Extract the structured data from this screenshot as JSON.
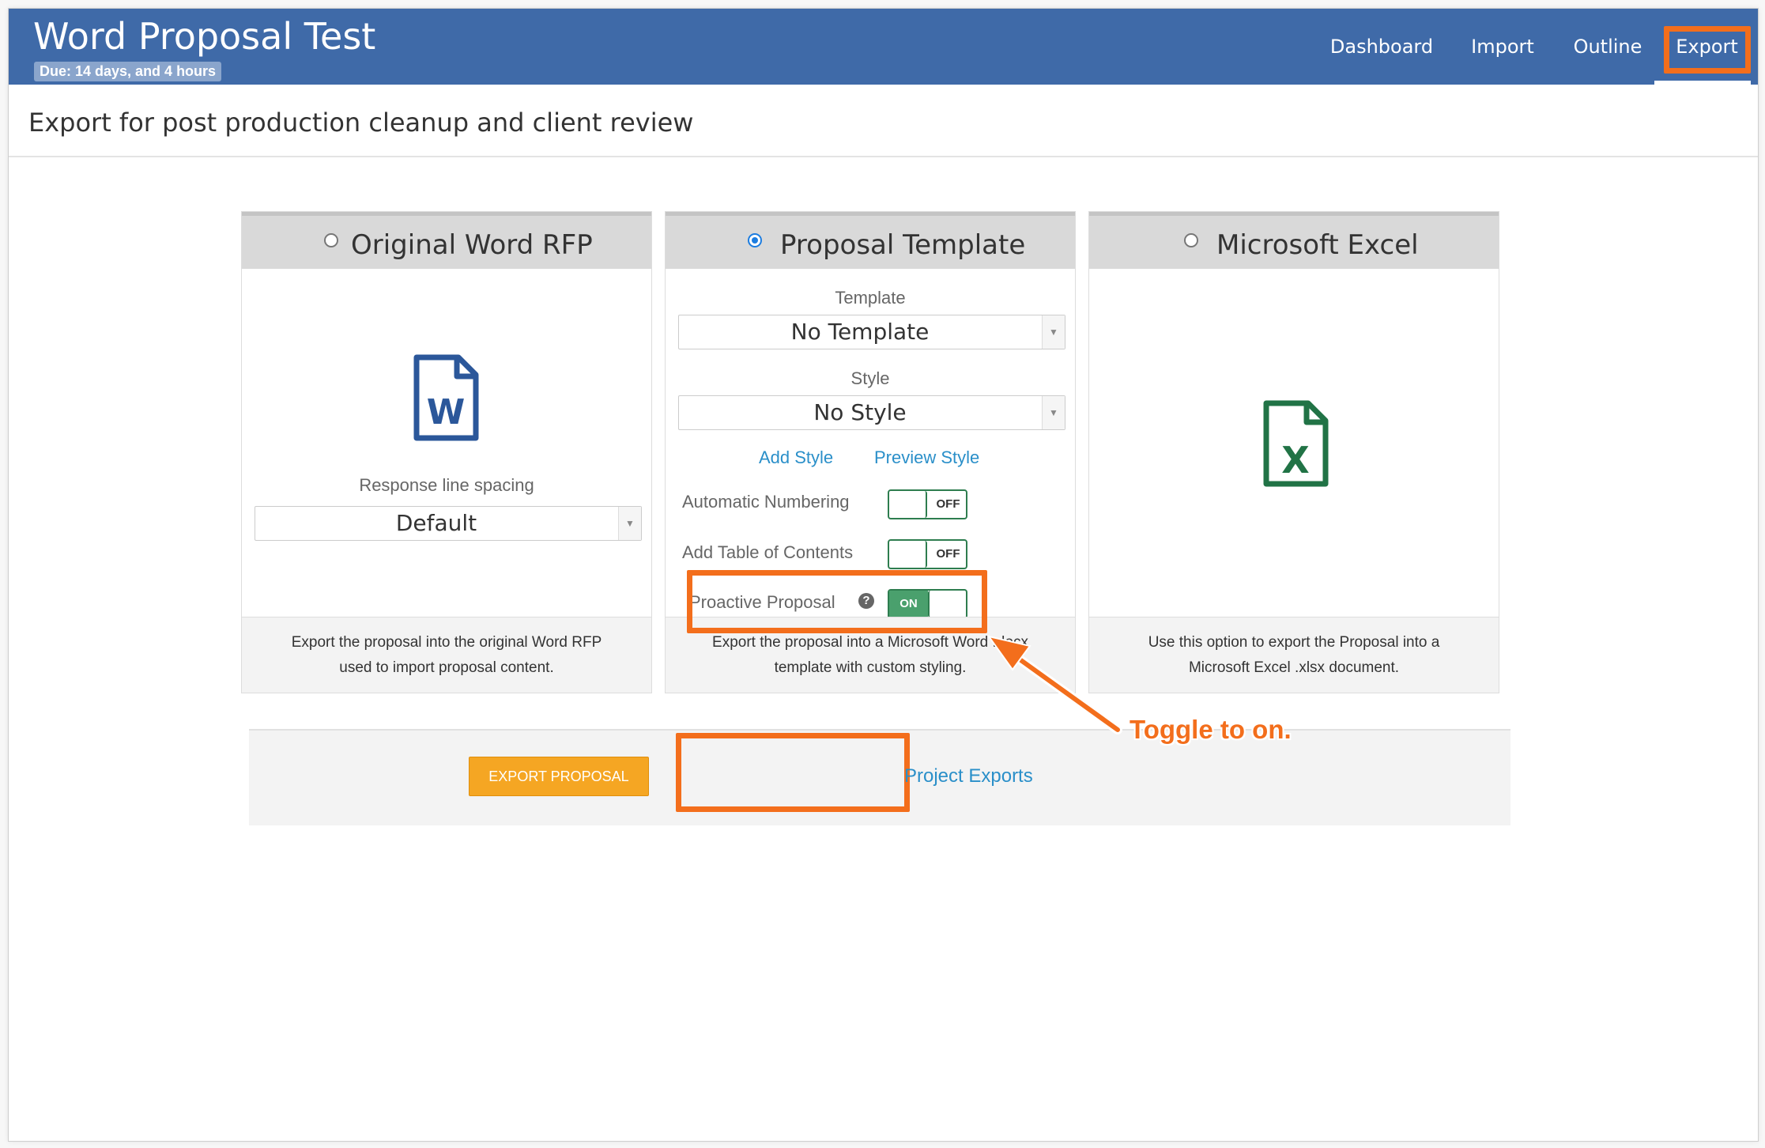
{
  "header": {
    "title": "Word Proposal Test",
    "due": "Due: 14 days, and 4 hours",
    "nav": [
      {
        "label": "Dashboard"
      },
      {
        "label": "Import"
      },
      {
        "label": "Outline"
      },
      {
        "label": "Export",
        "active": true
      }
    ]
  },
  "page": {
    "title": "Export for post production cleanup and client review"
  },
  "panels": {
    "word": {
      "title": "Original Word RFP",
      "selected": false,
      "icon": "word-file-icon",
      "spacing_label": "Response line spacing",
      "spacing_value": "Default",
      "description": "Export the proposal into the original Word RFP used to import proposal content."
    },
    "template": {
      "title": "Proposal Template",
      "selected": true,
      "template_label": "Template",
      "template_value": "No Template",
      "style_label": "Style",
      "style_value": "No Style",
      "add_style": "Add Style",
      "preview_style": "Preview Style",
      "options": [
        {
          "label": "Automatic Numbering",
          "state": "OFF"
        },
        {
          "label": "Add Table of Contents",
          "state": "OFF"
        },
        {
          "label": "Proactive Proposal",
          "state": "ON",
          "help_icon": "question-circle-icon"
        }
      ],
      "description": "Export the proposal into a Microsoft Word .docx template with custom styling."
    },
    "excel": {
      "title": "Microsoft Excel",
      "selected": false,
      "icon": "excel-file-icon",
      "description": "Use this option to export the Proposal into a Microsoft Excel .xlsx document."
    }
  },
  "actions": {
    "export_button": "EXPORT PROPOSAL",
    "project_exports": "Project Exports"
  },
  "annotation": {
    "text": "Toggle to on."
  },
  "colors": {
    "header": "#3f6aa8",
    "highlight": "#f36e1c",
    "button": "#f5a623",
    "link": "#2a8fc9",
    "toggle_on": "#4aa06d",
    "word_icon": "#2b579a",
    "excel_icon": "#217346"
  }
}
